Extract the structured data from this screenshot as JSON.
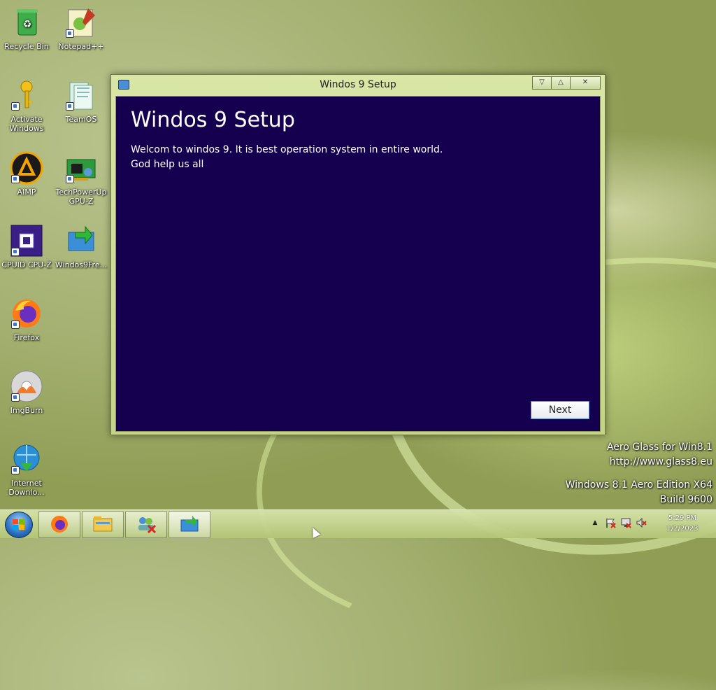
{
  "desktop": {
    "icons": [
      {
        "label": "Recycle Bin"
      },
      {
        "label": "Notepad++"
      },
      {
        "label": "Activate Windows"
      },
      {
        "label": "TeamOS"
      },
      {
        "label": "AIMP"
      },
      {
        "label": "TechPowerUp GPU-Z"
      },
      {
        "label": "CPUID CPU-Z"
      },
      {
        "label": "Windos9Fre..."
      },
      {
        "label": "Firefox"
      },
      {
        "label": "ImgBurn"
      },
      {
        "label": "Internet Downlo..."
      }
    ]
  },
  "window": {
    "title": "Windos 9 Setup",
    "heading": "Windos 9 Setup",
    "message_line1": "Welcom to windos 9. It is best operation system in entire world.",
    "message_line2": "God help us all",
    "next_label": "Next",
    "minimize_glyph": "▽",
    "maximize_glyph": "△",
    "close_glyph": "✕"
  },
  "watermark": {
    "line1": "Aero Glass for Win8.1",
    "line2": "http://www.glass8.eu",
    "line3": "Windows 8.1 Aero Edition X64",
    "line4": "Build 9600"
  },
  "taskbar": {
    "tray_chevron": "▲",
    "clock_time": "5:29 PM",
    "clock_date": "1/2/2023"
  },
  "colors": {
    "setup_background": "#14004f",
    "taskbar": "#c8d798"
  }
}
